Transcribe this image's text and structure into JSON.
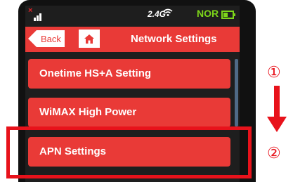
{
  "status_bar": {
    "band_label": "2.4G",
    "mode_label": "NOR",
    "signal_icon": "no-signal-icon",
    "wifi_icon": "wifi-icon",
    "battery_icon": "battery-icon"
  },
  "header": {
    "back_label": "Back",
    "home_icon": "home-icon",
    "title": "Network Settings"
  },
  "menu": {
    "items": [
      {
        "label": "Onetime HS+A Setting"
      },
      {
        "label": "WiMAX High Power"
      },
      {
        "label": "APN Settings"
      }
    ]
  },
  "annotations": {
    "step1": "①",
    "step2": "②",
    "highlight_color": "#e8121b"
  },
  "colors": {
    "accent": "#e93a37",
    "status_green": "#7dd61a"
  }
}
